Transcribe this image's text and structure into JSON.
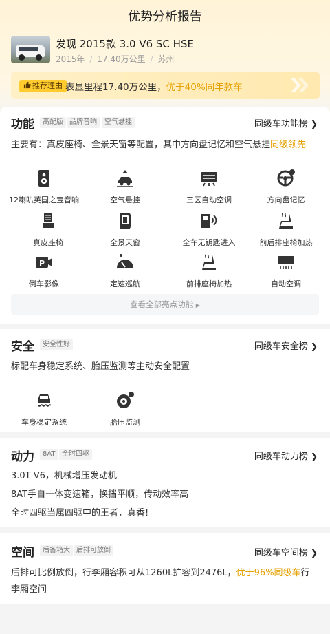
{
  "header": {
    "title": "优势分析报告"
  },
  "car": {
    "name": "发现 2015款 3.0 V6 SC HSE",
    "year": "2015年",
    "mileage": "17.40万公里",
    "city": "苏州",
    "sep": "/"
  },
  "reason": {
    "tag": "推荐理由",
    "text": "表显里程17.40万公里，",
    "highlight": "优于40%同年款车"
  },
  "function": {
    "title": "功能",
    "tags": [
      "高配版",
      "品牌音响",
      "空气悬挂"
    ],
    "rank": "同级车功能榜",
    "desc": "主要有：真皮座椅、全景天窗等配置，其中方向盘记忆和空气悬挂",
    "desc_hl": "同级领先",
    "features": [
      {
        "label": "12喇叭英国之宝音响",
        "icon": "speaker-icon"
      },
      {
        "label": "空气悬挂",
        "icon": "air-suspension-icon"
      },
      {
        "label": "三区自动空调",
        "icon": "climate-control-icon"
      },
      {
        "label": "方向盘记忆",
        "icon": "steering-wheel-icon"
      },
      {
        "label": "真皮座椅",
        "icon": "leather-seat-icon"
      },
      {
        "label": "全景天窗",
        "icon": "sunroof-icon"
      },
      {
        "label": "全车无钥匙进入",
        "icon": "keyless-entry-icon"
      },
      {
        "label": "前后排座椅加热",
        "icon": "seat-heating-icon"
      },
      {
        "label": "倒车影像",
        "icon": "parking-camera-icon"
      },
      {
        "label": "定速巡航",
        "icon": "cruise-control-icon"
      },
      {
        "label": "前排座椅加热",
        "icon": "front-seat-heating-icon"
      },
      {
        "label": "自动空调",
        "icon": "auto-ac-icon"
      }
    ],
    "view_all": "查看全部亮点功能"
  },
  "safety": {
    "title": "安全",
    "tags": [
      "安全性好"
    ],
    "rank": "同级车安全榜",
    "desc": "标配车身稳定系统、胎压监测等主动安全配置",
    "features": [
      {
        "label": "车身稳定系统",
        "icon": "stability-control-icon"
      },
      {
        "label": "胎压监测",
        "icon": "tire-pressure-icon"
      }
    ]
  },
  "power": {
    "title": "动力",
    "tags": [
      "8AT",
      "全时四驱"
    ],
    "rank": "同级车动力榜",
    "lines": [
      "3.0T V6，机械增压发动机",
      "8AT手自一体变速箱，换挡平顺，传动效率高",
      "全时四驱当属四驱中的王者，真香!"
    ]
  },
  "space": {
    "title": "空间",
    "tags": [
      "后备箱大",
      "后排可放倒"
    ],
    "rank": "同级车空间榜",
    "desc1": "后排可比例放倒，行李厢容积可从1260L扩容到2476L，",
    "desc1_hl": "优于96%同级车",
    "desc1_tail": "行",
    "desc2": "李厢空间"
  },
  "colors": {
    "accent": "#e6a100",
    "tag_bg": "#ffcb2f"
  }
}
